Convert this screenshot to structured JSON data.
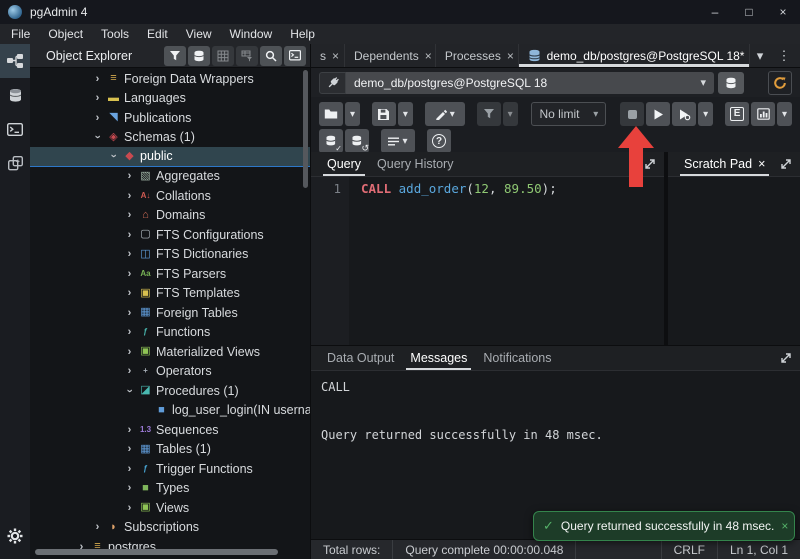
{
  "window": {
    "title": "pgAdmin 4",
    "controls": {
      "minimize": "–",
      "maximize": "□",
      "close": "×"
    }
  },
  "menu": {
    "items": [
      "File",
      "Object",
      "Tools",
      "Edit",
      "View",
      "Window",
      "Help"
    ]
  },
  "icons": {
    "chevron": "›",
    "caret_down": "▾",
    "kebab": "⋮",
    "close": "×",
    "check": "✓",
    "undo": "↺"
  },
  "object_explorer": {
    "title": "Object Explorer",
    "tree": [
      {
        "label": "Foreign Data Wrappers",
        "level": 2,
        "state": "collapsed",
        "icon": "foreign-data-wrapper-icon",
        "glyph": "≡",
        "color": "#d4aa4e"
      },
      {
        "label": "Languages",
        "level": 2,
        "state": "collapsed",
        "icon": "language-icon",
        "glyph": "▬",
        "color": "#d8c04f"
      },
      {
        "label": "Publications",
        "level": 2,
        "state": "collapsed",
        "icon": "publication-icon",
        "glyph": "◥",
        "color": "#6aa4e0"
      },
      {
        "label": "Schemas (1)",
        "level": 2,
        "state": "expanded",
        "icon": "schemas-icon",
        "glyph": "◈",
        "color": "#c84a50"
      },
      {
        "label": "public",
        "level": 3,
        "state": "expanded",
        "icon": "schema-icon",
        "glyph": "◆",
        "color": "#c84a50",
        "selected": true
      },
      {
        "label": "Aggregates",
        "level": 4,
        "state": "collapsed",
        "icon": "aggregate-icon",
        "glyph": "▧",
        "color": "#9fb3a5"
      },
      {
        "label": "Collations",
        "level": 4,
        "state": "collapsed",
        "icon": "collation-icon",
        "glyph": "A↓",
        "color": "#d05a52",
        "text_icon": true
      },
      {
        "label": "Domains",
        "level": 4,
        "state": "collapsed",
        "icon": "domain-icon",
        "glyph": "⌂",
        "color": "#cd6a55"
      },
      {
        "label": "FTS Configurations",
        "level": 4,
        "state": "collapsed",
        "icon": "fts-configuration-icon",
        "glyph": "▢",
        "color": "#aeb6bd"
      },
      {
        "label": "FTS Dictionaries",
        "level": 4,
        "state": "collapsed",
        "icon": "fts-dictionary-icon",
        "glyph": "◫",
        "color": "#5f9bd8"
      },
      {
        "label": "FTS Parsers",
        "level": 4,
        "state": "collapsed",
        "icon": "fts-parser-icon",
        "glyph": "Aa",
        "color": "#77b255",
        "text_icon": true
      },
      {
        "label": "FTS Templates",
        "level": 4,
        "state": "collapsed",
        "icon": "fts-template-icon",
        "glyph": "▣",
        "color": "#d8c04f"
      },
      {
        "label": "Foreign Tables",
        "level": 4,
        "state": "collapsed",
        "icon": "foreign-table-icon",
        "glyph": "▦",
        "color": "#5f9bd8"
      },
      {
        "label": "Functions",
        "level": 4,
        "state": "collapsed",
        "icon": "function-icon",
        "glyph": "ƒ",
        "color": "#49b8b0",
        "text_icon": true
      },
      {
        "label": "Materialized Views",
        "level": 4,
        "state": "collapsed",
        "icon": "materialized-view-icon",
        "glyph": "▣",
        "color": "#8fc455"
      },
      {
        "label": "Operators",
        "level": 4,
        "state": "collapsed",
        "icon": "operator-icon",
        "glyph": "+",
        "color": "#a8b0b8",
        "text_icon": true
      },
      {
        "label": "Procedures (1)",
        "level": 4,
        "state": "expanded",
        "icon": "procedure-icon",
        "glyph": "◪",
        "color": "#49b8b0"
      },
      {
        "label": "log_user_login(IN username te",
        "level": 5,
        "state": "leaf",
        "icon": "procedure-item-icon",
        "glyph": "■",
        "color": "#5f9bd8"
      },
      {
        "label": "Sequences",
        "level": 4,
        "state": "collapsed",
        "icon": "sequence-icon",
        "glyph": "1.3",
        "color": "#9d7bd8",
        "text_icon": true
      },
      {
        "label": "Tables (1)",
        "level": 4,
        "state": "collapsed",
        "icon": "table-icon",
        "glyph": "▦",
        "color": "#5f9bd8"
      },
      {
        "label": "Trigger Functions",
        "level": 4,
        "state": "collapsed",
        "icon": "trigger-function-icon",
        "glyph": "ƒ",
        "color": "#49a8d8",
        "text_icon": true
      },
      {
        "label": "Types",
        "level": 4,
        "state": "collapsed",
        "icon": "type-icon",
        "glyph": "■",
        "color": "#7fb55c"
      },
      {
        "label": "Views",
        "level": 4,
        "state": "collapsed",
        "icon": "view-icon",
        "glyph": "▣",
        "color": "#8fc455"
      },
      {
        "label": "Subscriptions",
        "level": 2,
        "state": "collapsed",
        "icon": "subscription-icon",
        "glyph": "◗",
        "color": "#e0a36a"
      },
      {
        "label": "postgres",
        "level": 1,
        "state": "collapsed",
        "icon": "server-icon",
        "glyph": "≡",
        "color": "#d4aa4e"
      }
    ]
  },
  "main_tabs": {
    "tabs": [
      {
        "label": "s",
        "close": true,
        "partial": true
      },
      {
        "label": "Dependents",
        "close": true
      },
      {
        "label": "Processes",
        "close": true
      },
      {
        "label": "demo_db/postgres@PostgreSQL 18*",
        "close": true,
        "icon": "database",
        "active": true
      }
    ]
  },
  "connection": {
    "value": "demo_db/postgres@PostgreSQL 18"
  },
  "toolbar": {
    "limit": "No limit",
    "explain_label": "E"
  },
  "query_panel": {
    "tabs": [
      {
        "label": "Query",
        "active": true
      },
      {
        "label": "Query History"
      }
    ],
    "line_number": "1",
    "code_tokens": [
      {
        "text": "CALL",
        "type": "keyword"
      },
      {
        "text": " ",
        "type": "plain"
      },
      {
        "text": "add_order",
        "type": "function"
      },
      {
        "text": "(",
        "type": "plain"
      },
      {
        "text": "12",
        "type": "number"
      },
      {
        "text": ", ",
        "type": "plain"
      },
      {
        "text": "89.50",
        "type": "number"
      },
      {
        "text": ");",
        "type": "plain"
      }
    ]
  },
  "scratch_pad": {
    "label": "Scratch Pad"
  },
  "output_panel": {
    "tabs": [
      {
        "label": "Data Output"
      },
      {
        "label": "Messages",
        "active": true
      },
      {
        "label": "Notifications"
      }
    ],
    "messages": [
      "CALL",
      "",
      "",
      "Query returned successfully in 48 msec."
    ]
  },
  "toast": {
    "message": "Query returned successfully in 48 msec."
  },
  "status_bar": {
    "total_rows_label": "Total rows:",
    "query_complete": "Query complete 00:00:00.048",
    "eol": "CRLF",
    "cursor": "Ln 1, Col 1"
  }
}
